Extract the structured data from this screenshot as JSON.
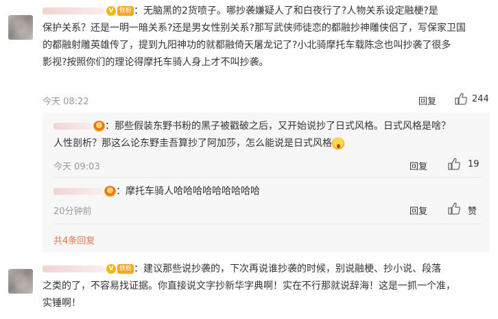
{
  "comments": [
    {
      "text_lines": [
        "：无脑黑的2货喷子。哪抄袭嫌疑人了和白夜行了?人物关系设定融梗?是",
        "保护关系？还是一明一暗关系?还是男女性别关系?那写武侠师徒恋的都融抄神雕侠侣了，写保家卫国",
        "的都融射雕英雄传了，提到九阳神功的就都融倚天屠龙记了?小北骑摩托车载陈念也叫抄袭了很多",
        "影视?按照你们的理论得摩托车骑人身上才不叫抄袭。"
      ],
      "badge_v": "V",
      "badge_fan": "铁粉",
      "time": "今天 08:22",
      "reply_label": "回复",
      "like_count": "244"
    },
    {
      "text_lines": [
        "：那些假装东野书粉的黑子被戳破之后，又开始说抄了日式风格。日式风格是啥？",
        "人性剖析？那这么论东野圭吾算抄了阿加莎，怎么能说是日式风格"
      ],
      "time": "今天 09:03",
      "reply_label": "回复",
      "like_count": "19"
    },
    {
      "text_lines": [
        "：摩托车骑人哈哈哈哈哈哈哈哈哈"
      ],
      "time": "20分钟前",
      "reply_label": "回复",
      "like_label": "赞"
    },
    {
      "text_lines": [
        "：建议那些说抄袭的，下次再说谁抄袭的时候，别说融梗、抄小说、段落",
        "之类的了，不容易找证据。你直接说文字抄新华字典啊！实在不行那就说辞海！这是一抓一个准，",
        "实锤啊！"
      ],
      "badge_v": "V",
      "badge_fan": "铁粉"
    }
  ],
  "more_replies": "共4条回复",
  "colors": {
    "link": "#eb7350",
    "meta": "#999999",
    "reply_bg": "#f7f7f7"
  },
  "icons": [
    "like-icon",
    "vip-icon",
    "fan-badge",
    "user-badge-icon",
    "sweat-emoji"
  ]
}
